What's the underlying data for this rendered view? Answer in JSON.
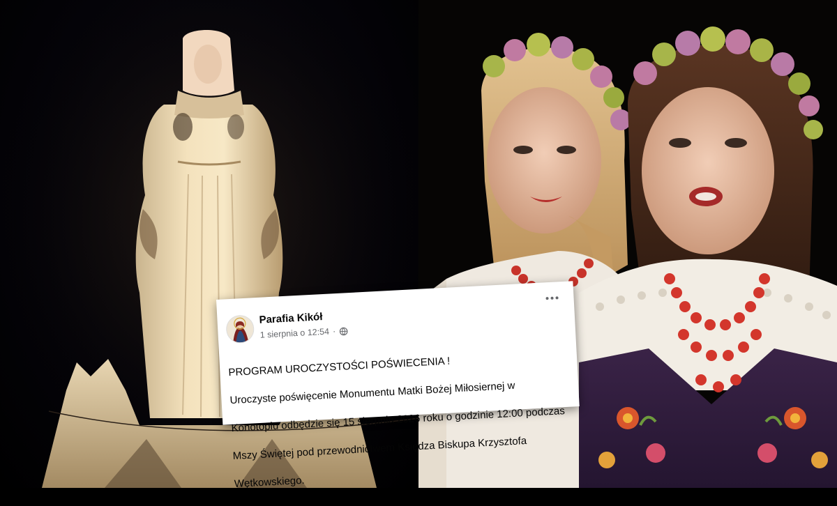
{
  "post": {
    "page_name": "Parafia Kikół",
    "timestamp": "1 sierpnia o 12:54",
    "separator": "·",
    "audience_icon": "globe-icon",
    "more_icon": "more-options-icon",
    "text_line_1": "PROGRAM UROCZYSTOŚCI POŚWIECENIA  !",
    "text_line_2": "Uroczyste poświęcenie Monumentu Matki Bożej Miłosiernej w",
    "text_line_3": "Konotopiu odbędzie się 15 sierpnia 2026 roku o godzinie 12:00 podczas",
    "text_line_4": "Mszy Świętej pod przewodnictwem Księdza Biskupa Krzysztofa",
    "text_line_5": "Wętkowskiego."
  },
  "colors": {
    "card_background": "#ffffff",
    "name_text": "#050505",
    "meta_text": "#65676b"
  }
}
